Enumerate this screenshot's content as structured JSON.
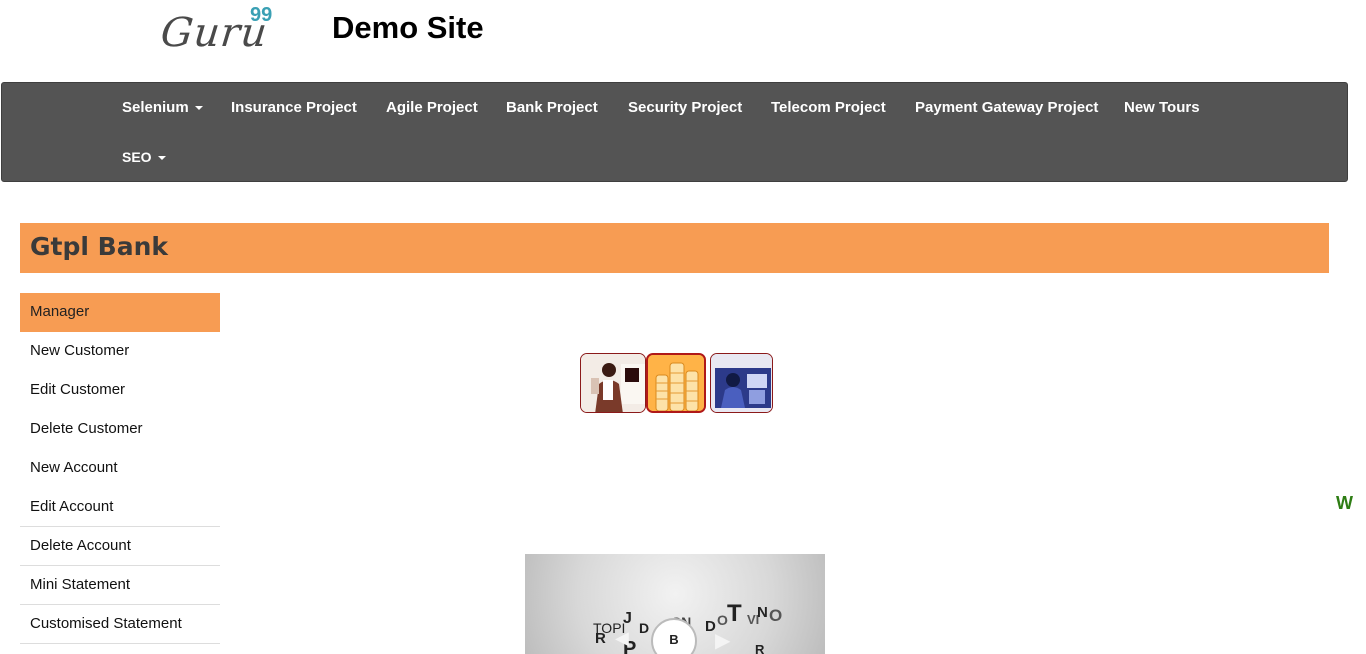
{
  "header": {
    "logo_text": "Guru",
    "logo_sup": "99",
    "site_title": "Demo Site"
  },
  "navbar": {
    "items": [
      {
        "label": "Selenium",
        "dropdown": true
      },
      {
        "label": "Insurance Project",
        "dropdown": false
      },
      {
        "label": "Agile Project",
        "dropdown": false
      },
      {
        "label": "Bank Project",
        "dropdown": false
      },
      {
        "label": "Security Project",
        "dropdown": false
      },
      {
        "label": "Telecom Project",
        "dropdown": false
      },
      {
        "label": "Payment Gateway Project",
        "dropdown": false
      },
      {
        "label": "New Tours",
        "dropdown": false
      },
      {
        "label": "SEO",
        "dropdown": true
      }
    ]
  },
  "bank": {
    "title": "Gtpl Bank"
  },
  "sidebar": {
    "items": [
      {
        "label": "Manager",
        "active": true
      },
      {
        "label": "New Customer"
      },
      {
        "label": "Edit Customer"
      },
      {
        "label": "Delete Customer"
      },
      {
        "label": "New Account"
      },
      {
        "label": "Edit Account"
      },
      {
        "label": "Delete Account"
      },
      {
        "label": "Mini Statement"
      },
      {
        "label": "Customised Statement"
      }
    ]
  },
  "marquee": {
    "text": "W"
  },
  "video": {
    "text_a": "TOPI",
    "text_b": "B"
  },
  "colors": {
    "navbar_bg": "#545454",
    "accent_orange": "#f79c53",
    "logo_accent": "#3aa0b4",
    "marquee_green": "#2e7d14"
  }
}
